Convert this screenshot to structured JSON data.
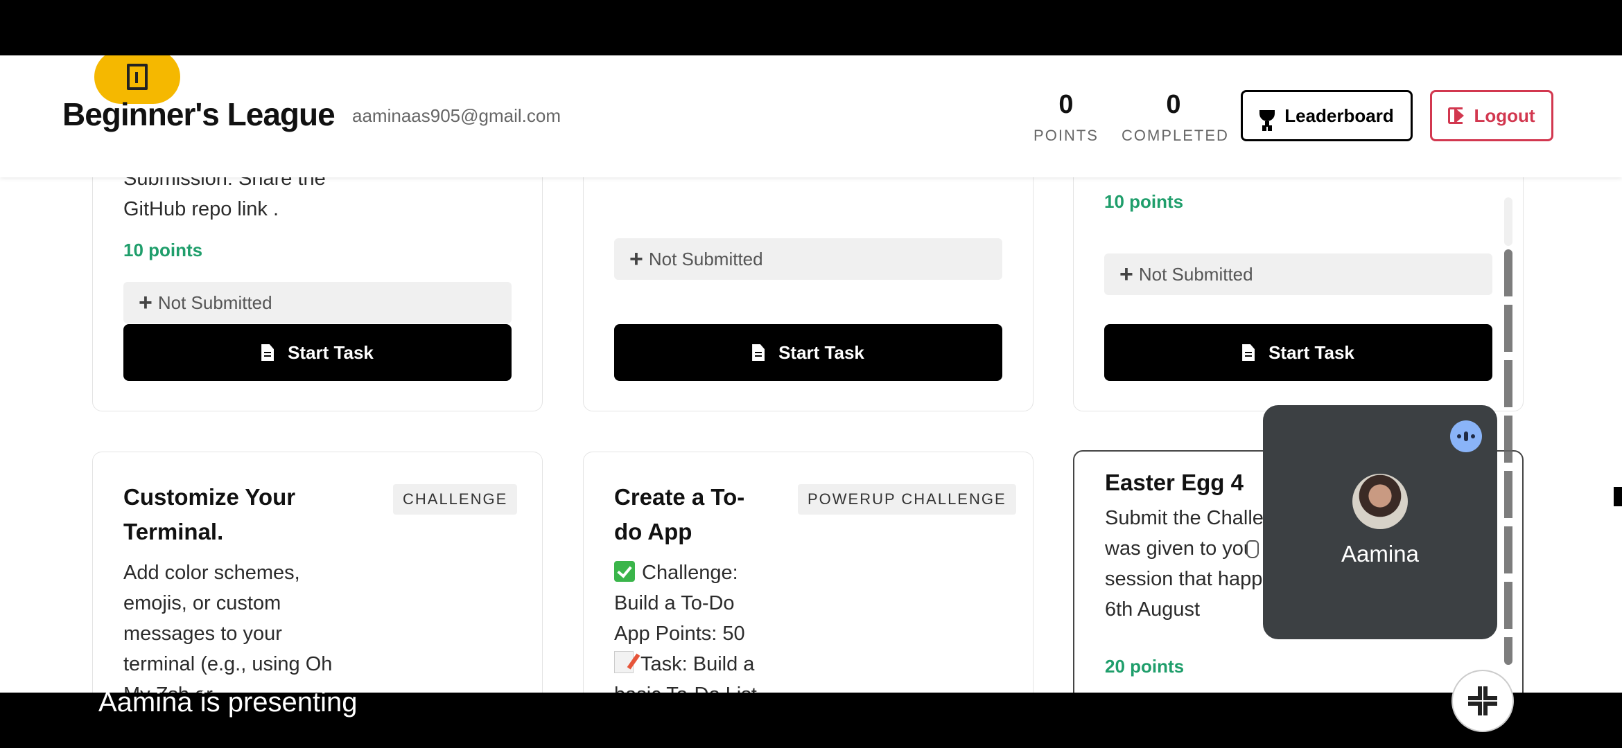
{
  "header": {
    "brand": "Beginner's League",
    "email": "aaminaas905@gmail.com",
    "points_value": "0",
    "points_label": "POINTS",
    "completed_value": "0",
    "completed_label": "COMPLETED",
    "leaderboard_label": "Leaderboard",
    "logout_label": "Logout"
  },
  "row1": [
    {
      "desc_lines": [
        "Submission: Share the",
        "GitHub repo link ."
      ],
      "points": "10 points",
      "status": "Not Submitted",
      "button": "Start Task"
    },
    {
      "status": "Not Submitted",
      "button": "Start Task"
    },
    {
      "points": "10 points",
      "status": "Not Submitted",
      "button": "Start Task"
    }
  ],
  "row2": [
    {
      "title_lines": [
        "Customize Your",
        "Terminal."
      ],
      "tag": "CHALLENGE",
      "desc_lines": [
        "Add color schemes,",
        "emojis, or custom",
        "messages to your",
        "terminal (e.g., using Oh",
        "My Zsh or"
      ]
    },
    {
      "title_lines": [
        "Create a To-",
        "do App"
      ],
      "tag": "POWERUP CHALLENGE",
      "desc_lines": [
        "Challenge:",
        "Build a To-Do",
        "App Points: 50",
        "Task: Build a",
        "basic To-Do List"
      ]
    },
    {
      "title": "Easter Egg 4",
      "desc_lines": [
        "Submit the Challe",
        "was given to you",
        "session that happ",
        "6th August"
      ],
      "points": "20 points"
    }
  ],
  "tile": {
    "name": "Aamina"
  },
  "footer": {
    "presenting": "Aamina is presenting"
  },
  "colors": {
    "accent_yellow": "#f5b800",
    "points_green": "#1f9e6b",
    "logout_red": "#d2374f"
  }
}
